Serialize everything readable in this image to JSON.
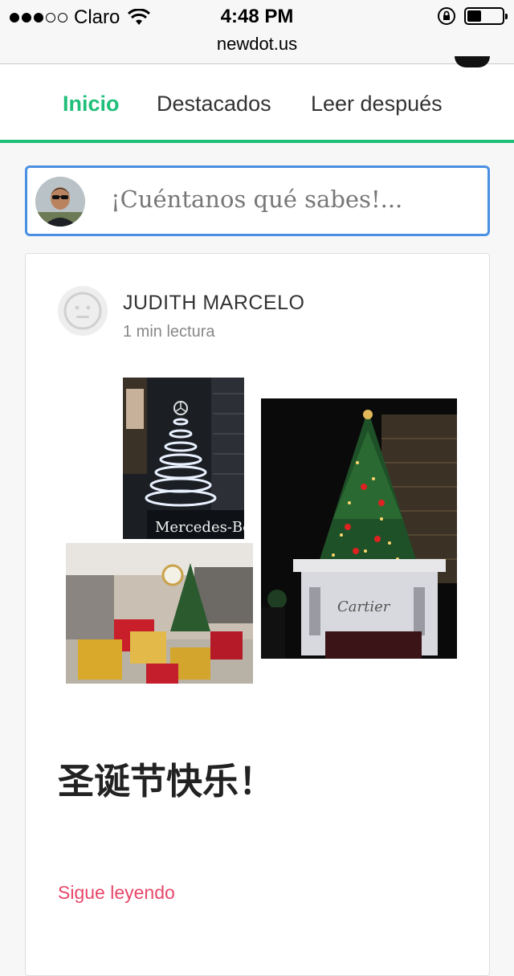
{
  "status_bar": {
    "carrier": "Claro",
    "time": "4:48 PM",
    "battery_level": 0.4
  },
  "browser": {
    "url": "newdot.us"
  },
  "tabs": [
    {
      "label": "Inicio",
      "active": true
    },
    {
      "label": "Destacados",
      "active": false
    },
    {
      "label": "Leer después",
      "active": false
    }
  ],
  "composer": {
    "placeholder": "¡Cuéntanos qué sabes!..."
  },
  "post": {
    "author": "JUDITH MARCELO",
    "read_time": "1 min lectura",
    "title": "圣诞节快乐！",
    "read_more": "Sigue leyendo",
    "image_signs": {
      "mercedes": "Mercedes-Benz",
      "cartier": "Cartier"
    }
  },
  "colors": {
    "accent_green": "#1fbf7a",
    "composer_border": "#4a90e2",
    "read_more": "#e8476a"
  }
}
